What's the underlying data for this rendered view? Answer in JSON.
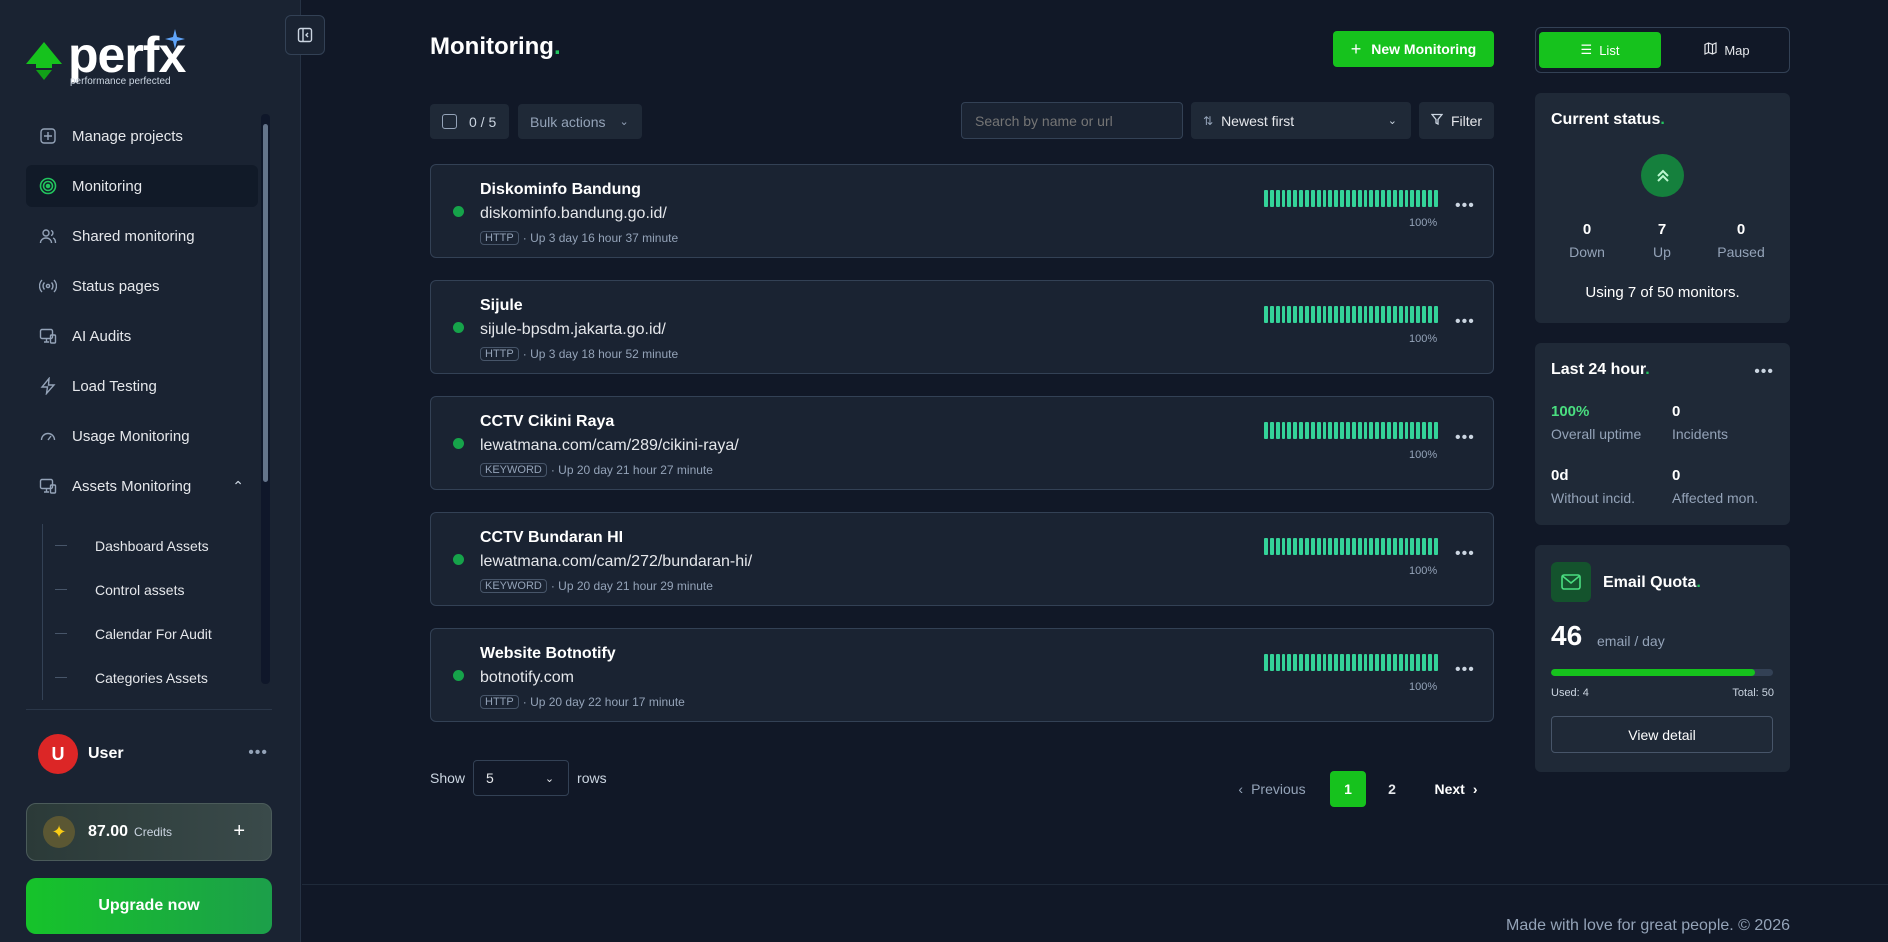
{
  "brand": {
    "name": "perfx",
    "tagline": "performance perfected"
  },
  "sidebar": {
    "items": [
      {
        "label": "Manage projects",
        "icon": "plus-square-icon"
      },
      {
        "label": "Monitoring",
        "icon": "target-icon",
        "active": true
      },
      {
        "label": "Shared monitoring",
        "icon": "users-icon"
      },
      {
        "label": "Status pages",
        "icon": "broadcast-icon"
      },
      {
        "label": "AI Audits",
        "icon": "monitor-icon"
      },
      {
        "label": "Load Testing",
        "icon": "bolt-icon"
      },
      {
        "label": "Usage Monitoring",
        "icon": "gauge-icon"
      },
      {
        "label": "Assets Monitoring",
        "icon": "devices-icon",
        "expanded": true
      }
    ],
    "subitems": [
      "Dashboard Assets",
      "Control assets",
      "Calendar For Audit",
      "Categories Assets"
    ],
    "user": {
      "initial": "U",
      "name": "User"
    },
    "credits": {
      "amount": "87.00",
      "label": "Credits"
    },
    "upgrade_label": "Upgrade now"
  },
  "main": {
    "title": "Monitoring",
    "title_dot": ".",
    "new_button": "New Monitoring",
    "selection_count": "0 / 5",
    "bulk_actions": "Bulk actions",
    "search_placeholder": "Search by name or url",
    "sort_label": "Newest first",
    "filter_label": "Filter",
    "monitors": [
      {
        "name": "Diskominfo Bandung",
        "url": "diskominfo.bandung.go.id/",
        "type": "HTTP",
        "uptime_text": "· Up 3 day 16 hour 37 minute",
        "uptime_pct": "100%",
        "status": "up"
      },
      {
        "name": "Sijule",
        "url": "sijule-bpsdm.jakarta.go.id/",
        "type": "HTTP",
        "uptime_text": "· Up 3 day 18 hour 52 minute",
        "uptime_pct": "100%",
        "status": "up"
      },
      {
        "name": "CCTV Cikini Raya",
        "url": "lewatmana.com/cam/289/cikini-raya/",
        "type": "KEYWORD",
        "uptime_text": "· Up 20 day 21 hour 27 minute",
        "uptime_pct": "100%",
        "status": "up"
      },
      {
        "name": "CCTV Bundaran HI",
        "url": "lewatmana.com/cam/272/bundaran-hi/",
        "type": "KEYWORD",
        "uptime_text": "· Up 20 day 21 hour 29 minute",
        "uptime_pct": "100%",
        "status": "up"
      },
      {
        "name": "Website Botnotify",
        "url": "botnotify.com",
        "type": "HTTP",
        "uptime_text": "· Up 20 day 22 hour 17 minute",
        "uptime_pct": "100%",
        "status": "up"
      }
    ],
    "show_label": "Show",
    "rows_value": "5",
    "rows_label": "rows",
    "pagination": {
      "prev": "Previous",
      "pages": [
        "1",
        "2"
      ],
      "current": "1",
      "next": "Next"
    },
    "footer": "Made with love for great people. © 2026"
  },
  "right": {
    "view_toggle": {
      "list": "List",
      "map": "Map",
      "active": "list"
    },
    "current_status": {
      "title": "Current status",
      "down": {
        "value": "0",
        "label": "Down"
      },
      "up": {
        "value": "7",
        "label": "Up"
      },
      "paused": {
        "value": "0",
        "label": "Paused"
      },
      "usage": "Using 7 of 50 monitors."
    },
    "last24": {
      "title": "Last 24 hour",
      "overall_uptime": {
        "value": "100%",
        "label": "Overall uptime"
      },
      "incidents": {
        "value": "0",
        "label": "Incidents"
      },
      "without_incid": {
        "value": "0d",
        "label": "Without incid."
      },
      "affected": {
        "value": "0",
        "label": "Affected mon."
      }
    },
    "email_quota": {
      "title": "Email Quota",
      "value": "46",
      "unit": "email / day",
      "used_label": "Used: 4",
      "total_label": "Total: 50",
      "fill_fraction": 0.92,
      "button": "View detail"
    }
  },
  "colors": {
    "accent": "#16c21d",
    "background": "#111827",
    "card": "#1f2937",
    "up": "#16a34a",
    "bar": "#34d399"
  }
}
